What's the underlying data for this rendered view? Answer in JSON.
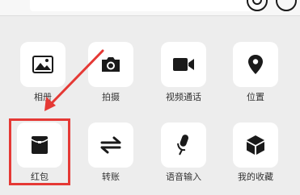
{
  "panel": {
    "items": [
      {
        "label": "相册",
        "icon": "photo-album-icon"
      },
      {
        "label": "拍摄",
        "icon": "camera-icon"
      },
      {
        "label": "视频通话",
        "icon": "video-call-icon"
      },
      {
        "label": "位置",
        "icon": "location-icon"
      },
      {
        "label": "红包",
        "icon": "red-packet-icon"
      },
      {
        "label": "转账",
        "icon": "transfer-icon"
      },
      {
        "label": "语音输入",
        "icon": "microphone-icon"
      },
      {
        "label": "我的收藏",
        "icon": "favorites-cube-icon"
      }
    ]
  },
  "annotation": {
    "highlight_color": "#e53935",
    "target": "红包"
  }
}
